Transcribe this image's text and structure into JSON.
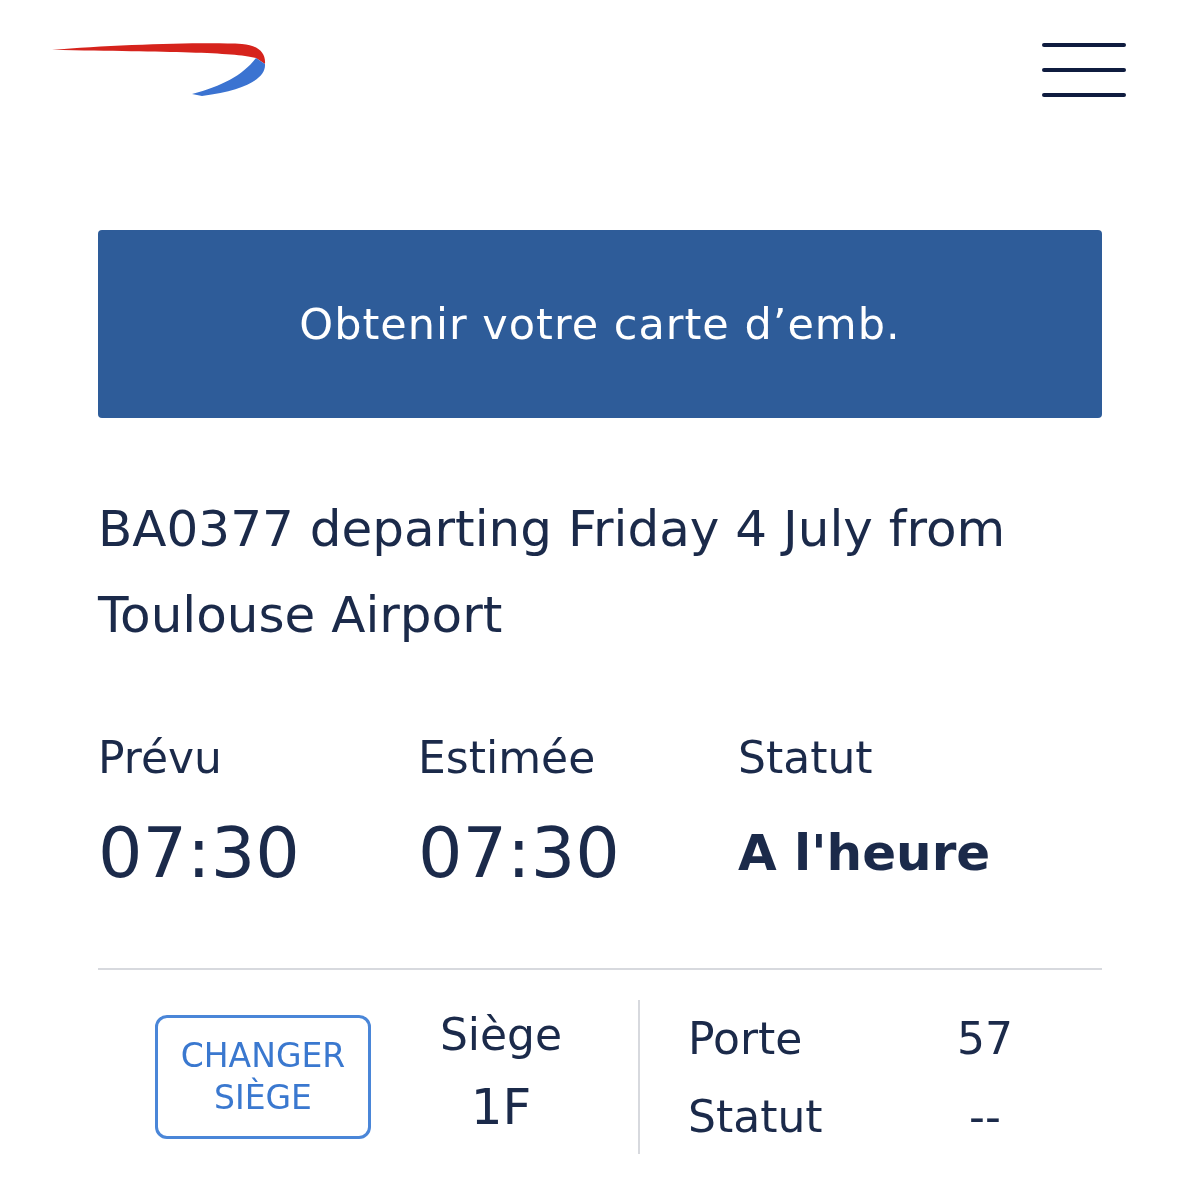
{
  "boarding_pass_button": {
    "label": "Obtenir votre carte d’emb."
  },
  "flight_summary": "BA0377 departing Friday 4 July from Toulouse Airport",
  "times": [
    {
      "label": "Prévu",
      "value": "07:30",
      "kind": "time"
    },
    {
      "label": "Estimée",
      "value": "07:30",
      "kind": "time"
    },
    {
      "label": "Statut",
      "value": "A l'heure",
      "kind": "status"
    }
  ],
  "seat": {
    "change_button": "CHANGER SIÈGE",
    "label": "Siège",
    "value": "1F"
  },
  "gate_info": [
    {
      "label": "Porte",
      "value": "57"
    },
    {
      "label": "Statut",
      "value": "--"
    }
  ]
}
